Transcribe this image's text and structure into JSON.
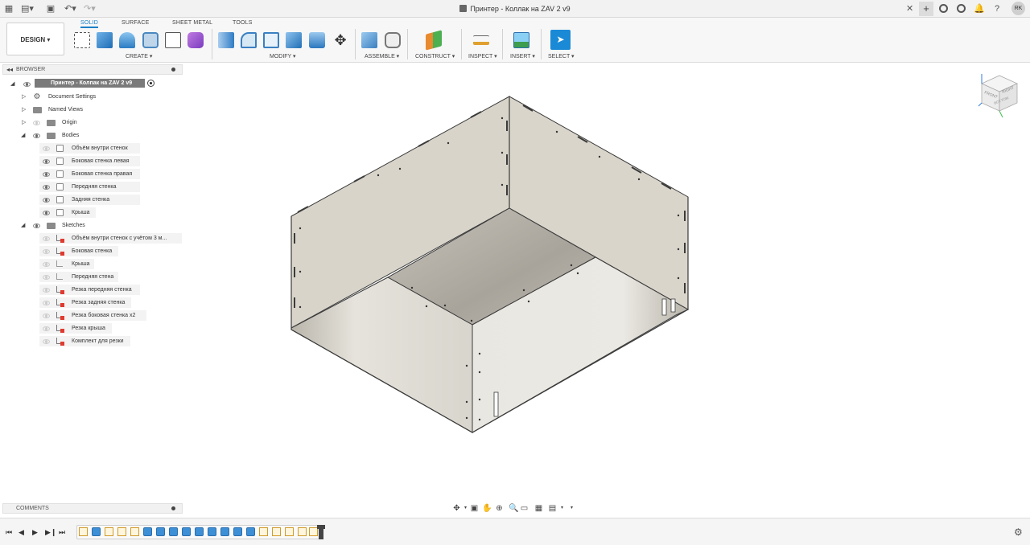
{
  "window": {
    "title": "Принтер - Коллак на ZAV 2 v9",
    "user_initials": "RK"
  },
  "ribbon": {
    "workspace": "DESIGN ▾",
    "tabs": [
      "SOLID",
      "SURFACE",
      "SHEET METAL",
      "TOOLS"
    ],
    "groups": {
      "create": "CREATE ▾",
      "modify": "MODIFY ▾",
      "assemble": "ASSEMBLE ▾",
      "construct": "CONSTRUCT ▾",
      "inspect": "INSPECT ▾",
      "insert": "INSERT ▾",
      "select": "SELECT ▾"
    }
  },
  "browser": {
    "header": "BROWSER",
    "root": "Принтер - Колпак на ZAV 2 v9",
    "document_settings": "Document Settings",
    "named_views": "Named Views",
    "origin": "Origin",
    "bodies_folder": "Bodies",
    "bodies": [
      "Объём внутри стенок",
      "Боковая стенка левая",
      "Боковая стенка правая",
      "Передняя стенка",
      "Задняя стенка",
      "Крыша"
    ],
    "sketches_folder": "Sketches",
    "sketches": [
      "Объём внутри стенок с учётом 3 м...",
      "Боковая стенка",
      "Крыша",
      "Передняя стена",
      "Резка передняя стенка",
      "Резка задняя стенка",
      "Резка боковая стенка х2",
      "Резка крыша",
      "Комплект для резки"
    ]
  },
  "comments": {
    "header": "COMMENTS"
  },
  "viewcube": {
    "front": "FRONT",
    "right": "RIGHT",
    "bottom": "BOTTOM"
  },
  "colors": {
    "accent": "#1b7fc6",
    "panel_fill": "#d6d2c8",
    "sketch_marker": "#e03a2f"
  }
}
